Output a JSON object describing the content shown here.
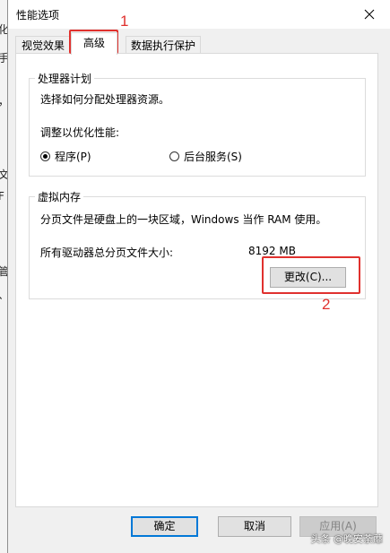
{
  "window": {
    "title": "性能选项"
  },
  "tabs": [
    {
      "label": "视觉效果"
    },
    {
      "label": "高级"
    },
    {
      "label": "数据执行保护"
    }
  ],
  "processor_group": {
    "title": "处理器计划",
    "description": "选择如何分配处理器资源。",
    "adjust_label": "调整以优化性能:",
    "options": [
      {
        "label": "程序(P)",
        "checked": true
      },
      {
        "label": "后台服务(S)",
        "checked": false
      }
    ]
  },
  "virtual_memory_group": {
    "title": "虚拟内存",
    "description": "分页文件是硬盘上的一块区域，Windows 当作 RAM 使用。",
    "total_label": "所有驱动器总分页文件大小:",
    "total_value": "8192 MB",
    "change_button": "更改(C)..."
  },
  "footer": {
    "ok": "确定",
    "cancel": "取消",
    "apply": "应用(A)"
  },
  "annotations": {
    "step1": "1",
    "step2": "2",
    "color": "#e0312e"
  },
  "behind_window": {
    "fragments": [
      "化",
      "手",
      "，",
      "文",
      "F",
      "管",
      "、"
    ]
  },
  "watermark": "头条 @晚安荼蘼",
  "colors": {
    "accent": "#0078d7",
    "dialog_bg": "#f0f0f0"
  }
}
